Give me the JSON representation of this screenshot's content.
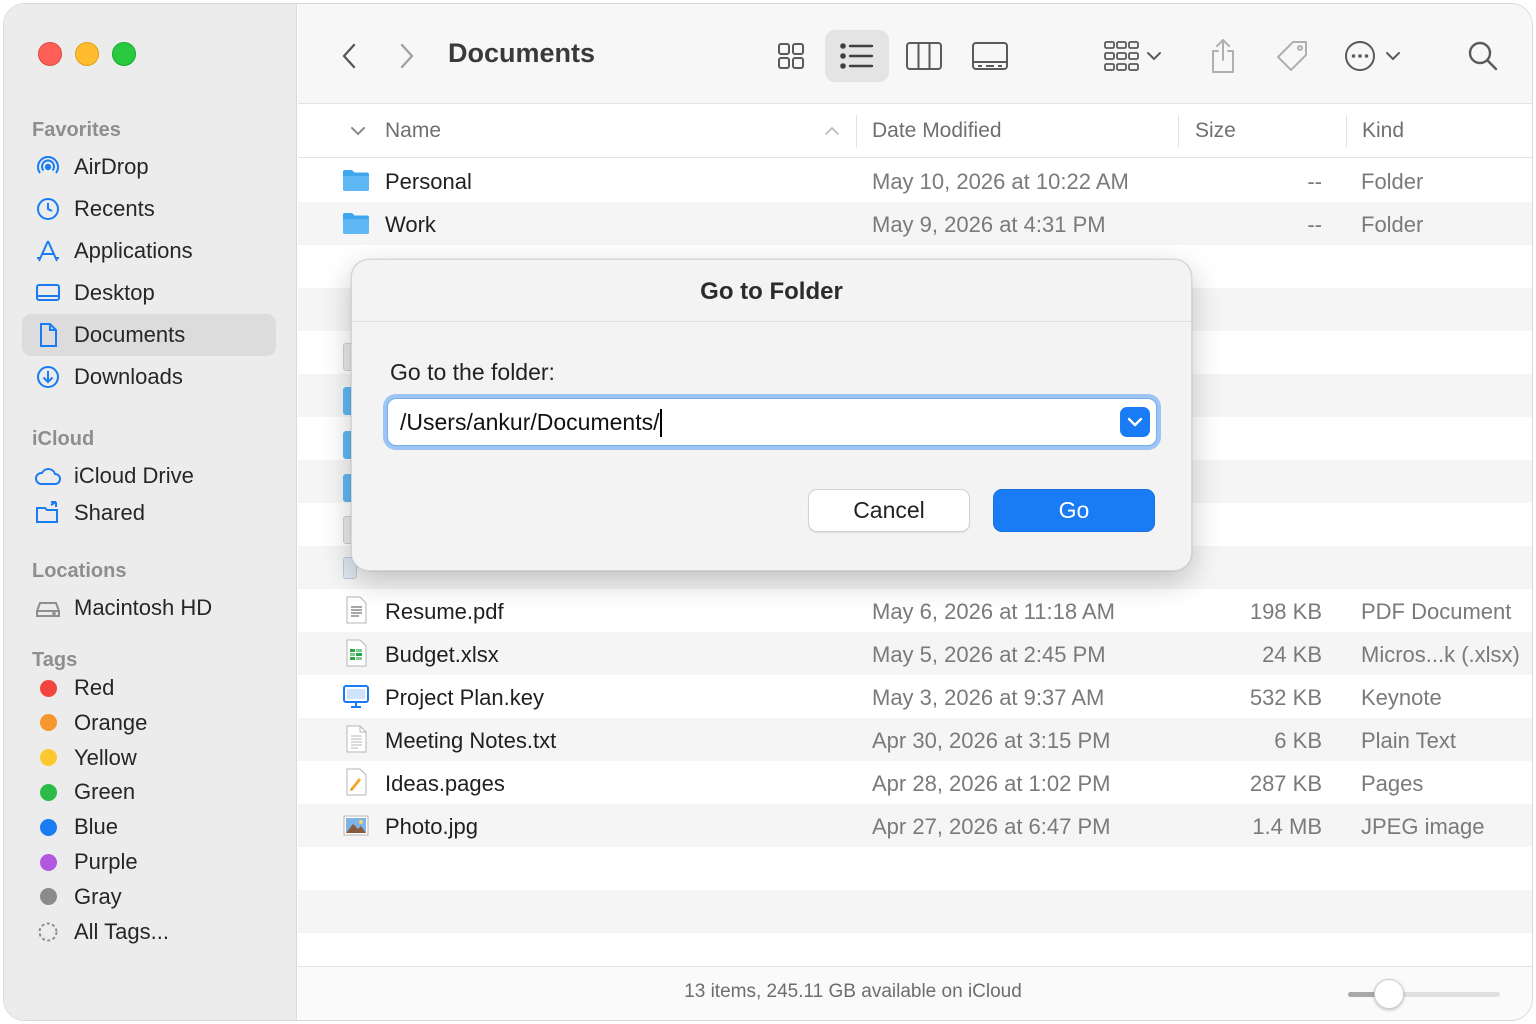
{
  "window": {
    "title": "Documents"
  },
  "sidebar": {
    "favorites_label": "Favorites",
    "favorites": [
      {
        "label": "AirDrop",
        "icon": "airdrop-icon"
      },
      {
        "label": "Recents",
        "icon": "clock-icon"
      },
      {
        "label": "Applications",
        "icon": "applications-icon"
      },
      {
        "label": "Desktop",
        "icon": "desktop-icon"
      },
      {
        "label": "Documents",
        "icon": "document-icon",
        "selected": true
      },
      {
        "label": "Downloads",
        "icon": "download-icon"
      }
    ],
    "icloud_label": "iCloud",
    "icloud": [
      {
        "label": "iCloud Drive",
        "icon": "cloud-icon"
      },
      {
        "label": "Shared",
        "icon": "shared-folder-icon"
      }
    ],
    "locations_label": "Locations",
    "locations": [
      {
        "label": "Macintosh HD",
        "icon": "disk-icon"
      }
    ],
    "tags_label": "Tags",
    "tags": [
      {
        "label": "Red",
        "color": "#f2453d"
      },
      {
        "label": "Orange",
        "color": "#f8962e"
      },
      {
        "label": "Yellow",
        "color": "#fbc92d"
      },
      {
        "label": "Green",
        "color": "#2dbb48"
      },
      {
        "label": "Blue",
        "color": "#1a7cf4"
      },
      {
        "label": "Purple",
        "color": "#b158e0"
      },
      {
        "label": "Gray",
        "color": "#8b8b8b"
      },
      {
        "label": "All Tags...",
        "icon": "all-tags-icon"
      }
    ]
  },
  "columns": {
    "name": "Name",
    "date": "Date Modified",
    "size": "Size",
    "kind": "Kind"
  },
  "files": [
    {
      "name": "Personal",
      "date": "May 10, 2026 at 10:22 AM",
      "size": "--",
      "kind": "Folder",
      "icon": "folder-icon"
    },
    {
      "name": "Work",
      "date": "May 9, 2026 at 4:31 PM",
      "size": "--",
      "kind": "Folder",
      "icon": "folder-icon"
    },
    {
      "name": "Resume.pdf",
      "date": "May 6, 2026 at 11:18 AM",
      "size": "198 KB",
      "kind": "PDF Document",
      "icon": "pdf-file-icon"
    },
    {
      "name": "Budget.xlsx",
      "date": "May 5, 2026 at 2:45 PM",
      "size": "24 KB",
      "kind": "Micros...k (.xlsx)",
      "icon": "spreadsheet-file-icon"
    },
    {
      "name": "Project Plan.key",
      "date": "May 3, 2026 at 9:37 AM",
      "size": "532 KB",
      "kind": "Keynote",
      "icon": "keynote-file-icon"
    },
    {
      "name": "Meeting Notes.txt",
      "date": "Apr 30, 2026 at 3:15 PM",
      "size": "6 KB",
      "kind": "Plain Text",
      "icon": "text-file-icon"
    },
    {
      "name": "Ideas.pages",
      "date": "Apr 28, 2026 at 1:02 PM",
      "size": "287 KB",
      "kind": "Pages",
      "icon": "pages-file-icon"
    },
    {
      "name": "Photo.jpg",
      "date": "Apr 27, 2026 at 6:47 PM",
      "size": "1.4 MB",
      "kind": "JPEG image",
      "icon": "image-file-icon"
    }
  ],
  "status": {
    "text": "13 items, 245.11 GB available on iCloud",
    "zoom_fraction": 0.27
  },
  "dialog": {
    "title": "Go to Folder",
    "prompt": "Go to the folder:",
    "path_value": "/Users/ankur/Documents/",
    "cancel_label": "Cancel",
    "go_label": "Go"
  },
  "colors": {
    "accent": "#1a7cf4",
    "folder": "#5fb8f3"
  }
}
